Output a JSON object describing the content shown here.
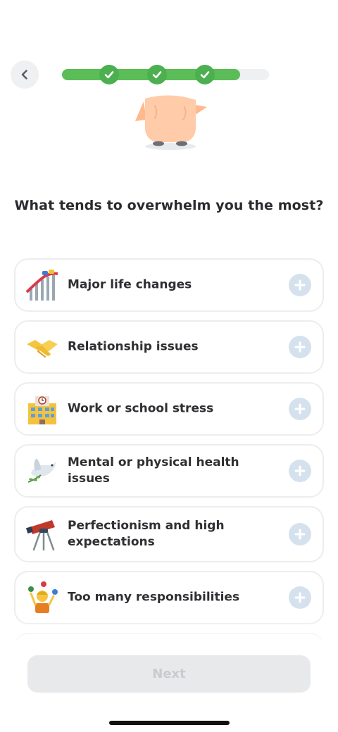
{
  "header": {
    "back_icon": "chevron-left-icon",
    "progress": {
      "fraction": 0.86,
      "completed_steps": 3,
      "check_icon": "checkmark-icon"
    }
  },
  "question": {
    "title": "What tends to overwhelm you the most?"
  },
  "options": [
    {
      "label": "Major life changes",
      "icon": "roller-coaster-icon"
    },
    {
      "label": "Relationship issues",
      "icon": "handshake-icon"
    },
    {
      "label": "Work or school stress",
      "icon": "office-building-icon"
    },
    {
      "label": "Mental or physical health issues",
      "icon": "dove-icon"
    },
    {
      "label": "Perfectionism and high expectations",
      "icon": "telescope-icon"
    },
    {
      "label": "Too many responsibilities",
      "icon": "juggling-person-icon"
    }
  ],
  "footer": {
    "next_label": "Next"
  },
  "colors": {
    "accent_green": "#4caf50",
    "plus_button": "#d5e2ee",
    "card_border": "#ecedef",
    "disabled_button": "#e8e9eb"
  }
}
